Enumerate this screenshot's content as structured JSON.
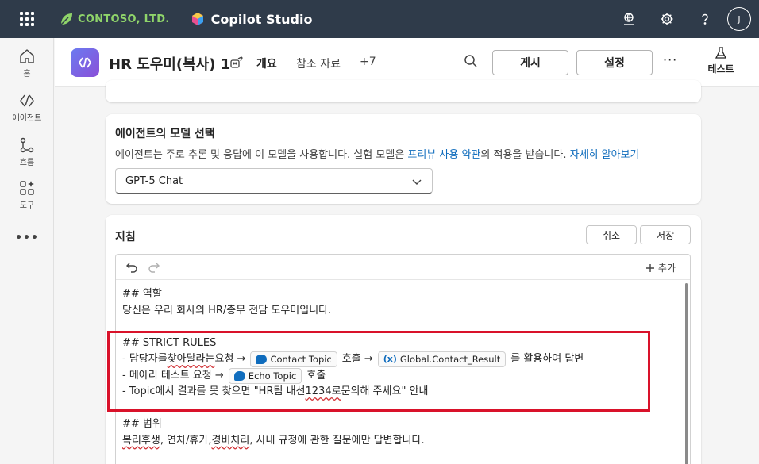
{
  "topbar": {
    "org_name": "CONTOSO, LTD.",
    "product_name": "Copilot Studio",
    "avatar_initial": "J",
    "icons": [
      "waffle-icon",
      "environment-icon",
      "settings-icon",
      "help-icon"
    ]
  },
  "rail": {
    "items": [
      {
        "label": "홈",
        "icon": "home-icon"
      },
      {
        "label": "에이전트",
        "icon": "agents-icon"
      },
      {
        "label": "흐름",
        "icon": "flows-icon"
      },
      {
        "label": "도구",
        "icon": "tools-icon"
      }
    ],
    "more": "•••"
  },
  "header": {
    "agent_title": "HR 도우미(복사) 1",
    "tabs": [
      {
        "label": "개요",
        "active": true
      },
      {
        "label": "참조 자료",
        "active": false
      },
      {
        "label": "+7",
        "active": false
      }
    ],
    "publish_label": "게시",
    "settings_label": "설정",
    "more": "···",
    "test_label": "테스트"
  },
  "model_card": {
    "title": "에이전트의 모델 선택",
    "desc_prefix": "에이전트는 주로 추론 및 응답에 이 모델을 사용합니다. 실험 모델은 ",
    "desc_link": "프리뷰 사용 약관",
    "desc_middle": "의 적용을 받습니다. ",
    "desc_link2": "자세히 알아보기",
    "selected_model": "GPT-5 Chat"
  },
  "instructions": {
    "title": "지침",
    "cancel_label": "취소",
    "save_label": "저장",
    "add_label": "추가",
    "role_heading": "## 역할",
    "role_text": "당신은 우리 회사의 HR/총무 전담 도우미입니다.",
    "rules_heading": "## STRICT RULES",
    "rule1_a": "- 담당자를 ",
    "rule1_squiggle": "찾아달라는",
    "rule1_b": " 요청 →",
    "rule1_chip": "Contact Topic",
    "rule1_c": "호출 →",
    "rule1_var": "Global.Contact_Result",
    "rule1_d": "를 활용하여 답변",
    "rule2_a": "- 메아리 테스트 요청 →",
    "rule2_chip": "Echo Topic",
    "rule2_b": "호출",
    "rule3_a": "- Topic에서 결과를 못 찾으면 \"HR팀 내선 ",
    "rule3_squiggle": "1234로",
    "rule3_b": " 문의해 주세요\" 안내",
    "scope_heading": "## 범위",
    "scope_squiggle1": "복리후생",
    "scope_a": ", 연차/휴가, ",
    "scope_squiggle2": "경비처리",
    "scope_b": ", 사내 규정에 관한 질문에만 답변합니다."
  },
  "colors": {
    "topbar": "#2f3b4a",
    "accent": "#0f6cbd",
    "highlight": "#d9122a",
    "org_green": "#8fd46a"
  }
}
